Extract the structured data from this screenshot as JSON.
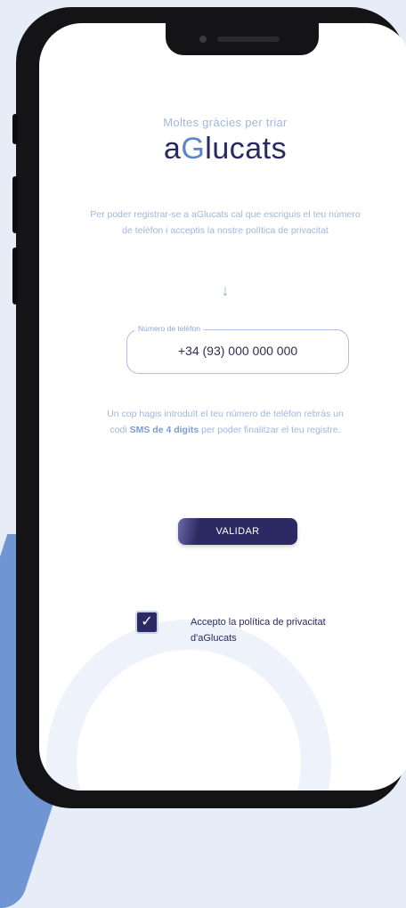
{
  "header": {
    "thanks": "Moltes gràcies per triar",
    "logo_prefix": "a",
    "logo_g": "G",
    "logo_suffix": "lucats"
  },
  "intro_text": "Per poder registrar-se a aGlucats cal que escriguis el teu número de telèfon i acceptis la nostre política de privacitat",
  "arrow_icon": "arrow-down",
  "phone_field": {
    "label": "Número de telèfon",
    "value": "+34 (93) 000 000 000"
  },
  "sms_info": {
    "part1": "Un cop hagis introduït el teu número de telèfon rebràs un codi ",
    "bold": "SMS de 4 digits",
    "part2": " per poder finalitzar el teu registre."
  },
  "validate_label": "VALIDAR",
  "privacy": {
    "checked": true,
    "label": "Accepto la política de privacitat d'aGlucats"
  },
  "colors": {
    "brand": "#2b2a63",
    "accent": "#5b86cf",
    "light_text": "#9fb7e2"
  }
}
